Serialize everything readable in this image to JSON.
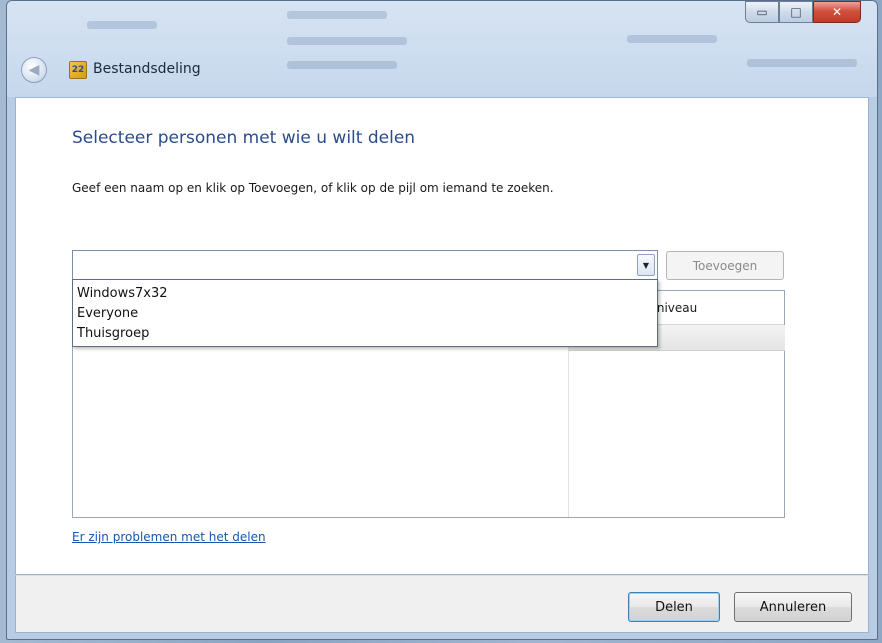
{
  "window": {
    "title": "Bestandsdeling",
    "app_icon_glyph": "22",
    "controls": {
      "minimize": "▭",
      "maximize": "□",
      "close": "✕"
    }
  },
  "icons": {
    "back": "back-arrow-icon",
    "app": "file-sharing-icon",
    "dropdown_arrow": "chevron-down-icon"
  },
  "main": {
    "heading": "Selecteer personen met wie u wilt delen",
    "instruction": "Geef een naam op en klik op Toevoegen, of klik op de pijl om iemand te zoeken.",
    "name_input": {
      "value": "",
      "placeholder": ""
    },
    "add_button": "Toevoegen",
    "dropdown_options": [
      "Windows7x32",
      "Everyone",
      "Thuisgroep"
    ],
    "list": {
      "columns": [
        "",
        "gsniveau"
      ]
    },
    "problems_link": "Er zijn problemen met het delen"
  },
  "footer": {
    "share_button": "Delen",
    "cancel_button": "Annuleren"
  },
  "colors": {
    "heading": "#2a4c8c",
    "link": "#1a55b0",
    "close_button": "#c13a28"
  }
}
